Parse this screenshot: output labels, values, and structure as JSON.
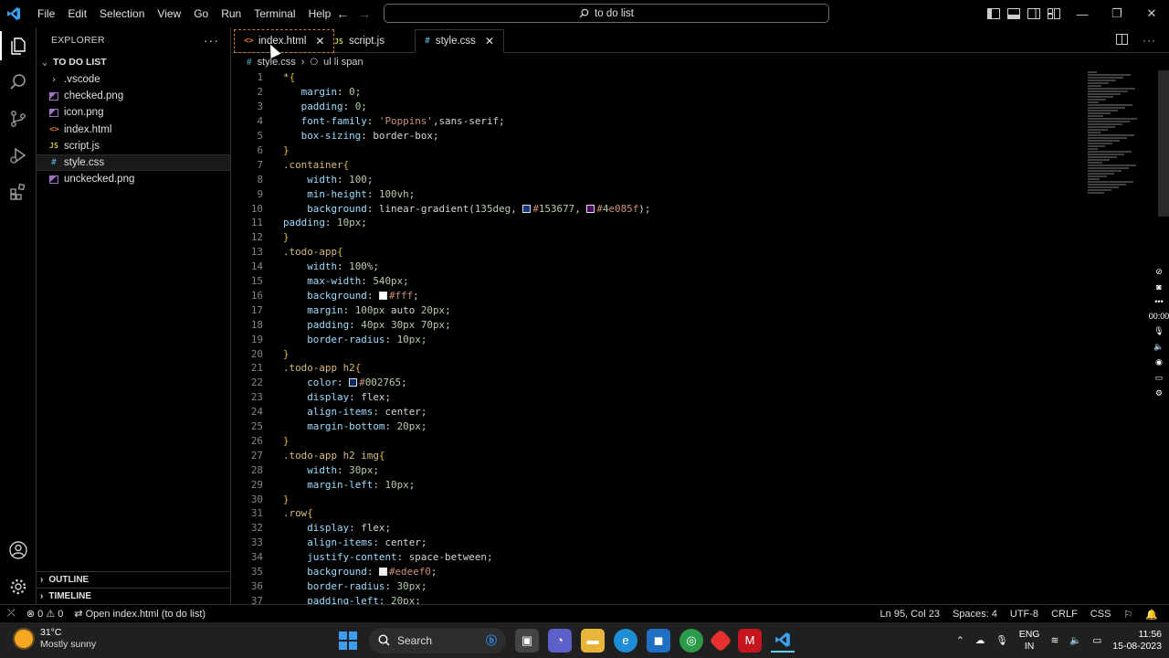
{
  "menu": [
    "File",
    "Edit",
    "Selection",
    "View",
    "Go",
    "Run",
    "Terminal",
    "Help"
  ],
  "search": {
    "text": "to do list"
  },
  "explorer": {
    "header": "EXPLORER",
    "folder": "TO DO LIST",
    "items": [
      ".vscode",
      "checked.png",
      "icon.png",
      "index.html",
      "script.js",
      "style.css",
      "unckecked.png"
    ],
    "outline": "OUTLINE",
    "timeline": "TIMELINE"
  },
  "tabs": [
    {
      "label": "index.html"
    },
    {
      "label": "script.js"
    },
    {
      "label": "style.css"
    }
  ],
  "breadcrumb": {
    "file": "style.css",
    "symbol": "ul li span"
  },
  "code": [
    {
      "n": "1",
      "t": "*{"
    },
    {
      "n": "2",
      "t": "   margin: 0;"
    },
    {
      "n": "3",
      "t": "   padding: 0;"
    },
    {
      "n": "4",
      "t": "   font-family: 'Poppins',sans-serif;"
    },
    {
      "n": "5",
      "t": "   box-sizing: border-box;"
    },
    {
      "n": "6",
      "t": "}"
    },
    {
      "n": "7",
      "t": ".container{"
    },
    {
      "n": "8",
      "t": "    width: 100;"
    },
    {
      "n": "9",
      "t": "    min-height: 100vh;"
    },
    {
      "n": "10",
      "t": "    background: linear-gradient(135deg, #153677, #4e085f);"
    },
    {
      "n": "11",
      "t": "padding: 10px;"
    },
    {
      "n": "12",
      "t": "}"
    },
    {
      "n": "13",
      "t": ".todo-app{"
    },
    {
      "n": "14",
      "t": "    width: 100%;"
    },
    {
      "n": "15",
      "t": "    max-width: 540px;"
    },
    {
      "n": "16",
      "t": "    background: #fff;"
    },
    {
      "n": "17",
      "t": "    margin: 100px auto 20px;"
    },
    {
      "n": "18",
      "t": "    padding: 40px 30px 70px;"
    },
    {
      "n": "19",
      "t": "    border-radius: 10px;"
    },
    {
      "n": "20",
      "t": "}"
    },
    {
      "n": "21",
      "t": ".todo-app h2{"
    },
    {
      "n": "22",
      "t": "    color: #002765;"
    },
    {
      "n": "23",
      "t": "    display: flex;"
    },
    {
      "n": "24",
      "t": "    align-items: center;"
    },
    {
      "n": "25",
      "t": "    margin-bottom: 20px;"
    },
    {
      "n": "26",
      "t": "}"
    },
    {
      "n": "27",
      "t": ".todo-app h2 img{"
    },
    {
      "n": "28",
      "t": "    width: 30px;"
    },
    {
      "n": "29",
      "t": "    margin-left: 10px;"
    },
    {
      "n": "30",
      "t": "}"
    },
    {
      "n": "31",
      "t": ".row{"
    },
    {
      "n": "32",
      "t": "    display: flex;"
    },
    {
      "n": "33",
      "t": "    align-items: center;"
    },
    {
      "n": "34",
      "t": "    justify-content: space-between;"
    },
    {
      "n": "35",
      "t": "    background: #edeef0;"
    },
    {
      "n": "36",
      "t": "    border-radius: 30px;"
    },
    {
      "n": "37",
      "t": "    padding-left: 20px;"
    }
  ],
  "colors": {
    "swatches": {
      "#153677": "#153677",
      "#4e085f": "#4e085f",
      "#fff": "#ffffff",
      "#002765": "#002765",
      "#edeef0": "#edeef0"
    }
  },
  "float_bar": {
    "timer": "00:00"
  },
  "status": {
    "errors": "0",
    "warnings": "0",
    "message": "Open index.html (to do list)",
    "position": "Ln 95, Col 23",
    "spaces": "Spaces: 4",
    "encoding": "UTF-8",
    "eol": "CRLF",
    "language": "CSS"
  },
  "taskbar": {
    "temp": "31°C",
    "weather": "Mostly sunny",
    "search": "Search",
    "lang1": "ENG",
    "lang2": "IN",
    "time": "11:56",
    "date": "15-08-2023"
  }
}
